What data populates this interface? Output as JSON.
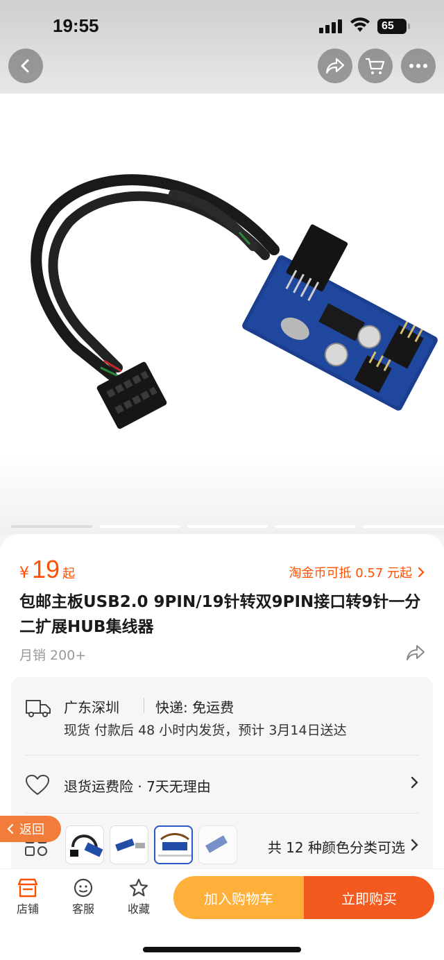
{
  "status_bar": {
    "time": "19:55",
    "battery": "65"
  },
  "nav": {
    "back_icon": "chevron-left-icon",
    "share_icon": "share-icon",
    "cart_icon": "cart-icon",
    "more_icon": "more-icon"
  },
  "product": {
    "price_symbol": "¥",
    "price": "19",
    "price_suffix": "起",
    "coin_offer": "淘金币可抵 0.57 元起",
    "title": "包邮主板USB2.0 9PIN/19针转双9PIN接口转9针一分二扩展HUB集线器",
    "monthly_sales": "月销 200+"
  },
  "shipping": {
    "origin": "广东深圳",
    "express": "快递: 免运费",
    "detail": "现货 付款后 48 小时内发货，预计 3月14日送达"
  },
  "return_policy": "退货运费险 · 7天无理由",
  "variants": {
    "summary": "共 12 种颜色分类可选"
  },
  "back_tag": "返回",
  "bottom_bar": {
    "store": "店铺",
    "service": "客服",
    "favorite": "收藏",
    "add_to_cart": "加入购物车",
    "buy_now": "立即购买"
  },
  "colors": {
    "accent": "#ff5000",
    "cart_button": "#ffb03a",
    "buy_button": "#f25a20"
  }
}
